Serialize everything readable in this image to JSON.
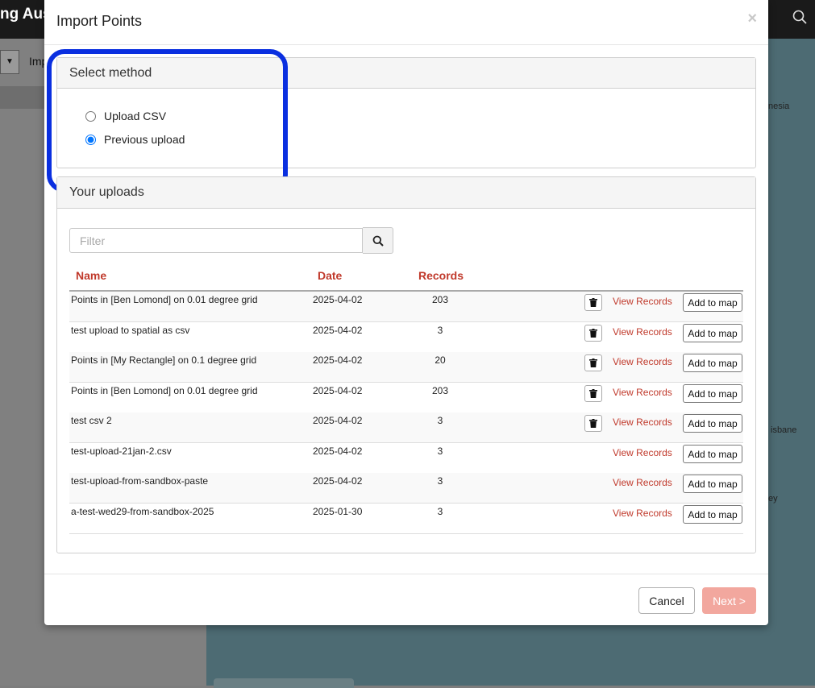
{
  "background": {
    "app_title": "ng Aus",
    "toolbar_item": "Imp",
    "map_labels": [
      "nesia",
      "isbane",
      "ey"
    ]
  },
  "modal": {
    "title": "Import Points",
    "close_glyph": "×",
    "select_method": {
      "heading": "Select method",
      "options": [
        {
          "label": "Upload CSV",
          "selected": false
        },
        {
          "label": "Previous upload",
          "selected": true
        }
      ]
    },
    "uploads": {
      "heading": "Your uploads",
      "filter_placeholder": "Filter",
      "columns": [
        "Name",
        "Date",
        "Records"
      ],
      "view_label": "View Records",
      "add_label": "Add to map",
      "rows": [
        {
          "name": "Points in [Ben Lomond] on 0.01 degree grid",
          "date": "2025-04-02",
          "records": "203",
          "deletable": true
        },
        {
          "name": "test upload to spatial as csv",
          "date": "2025-04-02",
          "records": "3",
          "deletable": true
        },
        {
          "name": "Points in [My Rectangle] on 0.1 degree grid",
          "date": "2025-04-02",
          "records": "20",
          "deletable": true
        },
        {
          "name": "Points in [Ben Lomond] on 0.01 degree grid",
          "date": "2025-04-02",
          "records": "203",
          "deletable": true
        },
        {
          "name": "test csv 2",
          "date": "2025-04-02",
          "records": "3",
          "deletable": true
        },
        {
          "name": "test-upload-21jan-2.csv",
          "date": "2025-04-02",
          "records": "3",
          "deletable": false
        },
        {
          "name": "test-upload-from-sandbox-paste",
          "date": "2025-04-02",
          "records": "3",
          "deletable": false
        },
        {
          "name": "a-test-wed29-from-sandbox-2025",
          "date": "2025-01-30",
          "records": "3",
          "deletable": false
        }
      ]
    },
    "footer": {
      "cancel_label": "Cancel",
      "next_label": "Next >"
    }
  },
  "colors": {
    "accent_red": "#c0392b",
    "highlight_blue": "#0a2fe0",
    "next_disabled": "#f2a79e"
  }
}
